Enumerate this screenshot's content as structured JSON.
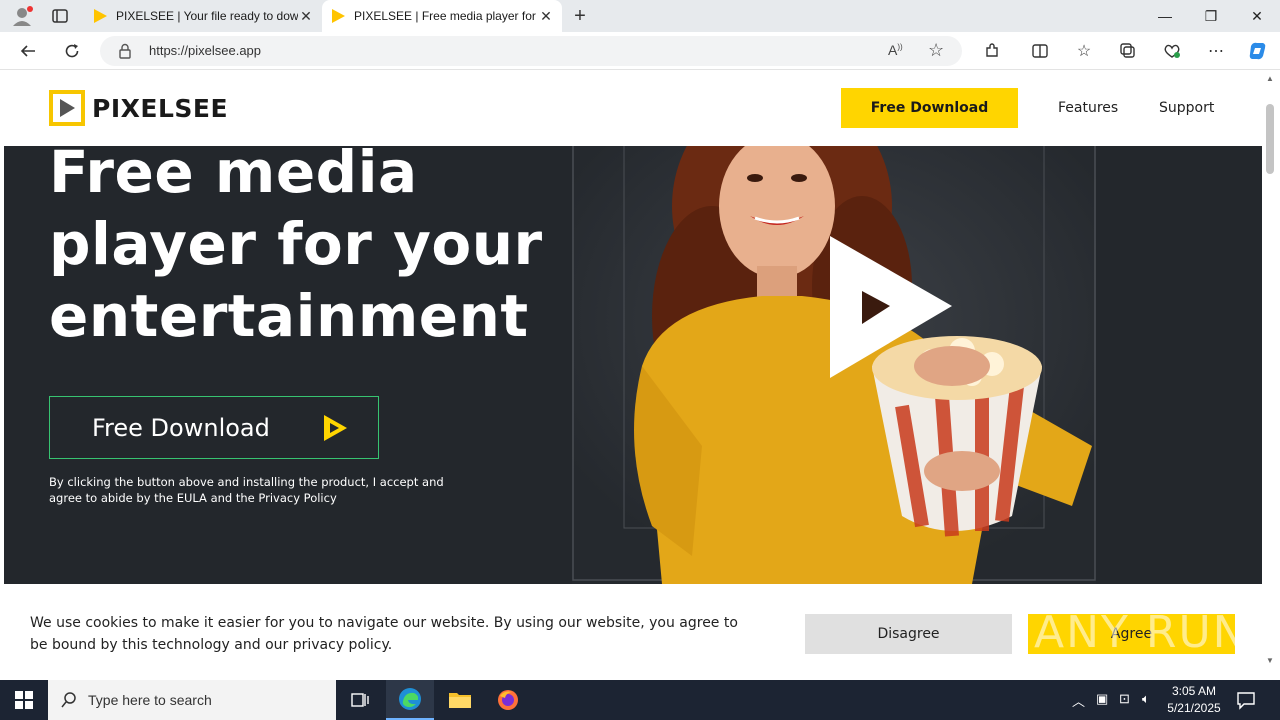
{
  "browser": {
    "tabs": [
      {
        "title": "PIXELSEE | Your file ready to download",
        "active": false
      },
      {
        "title": "PIXELSEE | Free media player for your entertainment",
        "active": true
      }
    ],
    "url": "https://pixelsee.app"
  },
  "site": {
    "logo_text": "PIXELSEE",
    "nav": {
      "download_label": "Free Download",
      "features_label": "Features",
      "support_label": "Support"
    },
    "hero": {
      "title_line1": "Free media",
      "title_line2": "player for your",
      "title_line3": "entertainment",
      "download_label": "Free Download",
      "note": "By clicking the button above and installing the product, I accept and agree to abide by the EULA and the Privacy Policy"
    },
    "cookie": {
      "text": "We use cookies to make it easier for you to navigate our website. By using our website, you agree to be bound by this technology and our privacy policy.",
      "disagree_label": "Disagree",
      "agree_label": "Agree"
    },
    "watermark": "ANY RUN"
  },
  "taskbar": {
    "search_placeholder": "Type here to search",
    "time": "3:05 AM",
    "date": "5/21/2025"
  },
  "colors": {
    "brand_yellow": "#ffd500",
    "hero_bg": "#23272c",
    "hero_button_border": "#37c371",
    "taskbar_bg": "#1c2433"
  }
}
